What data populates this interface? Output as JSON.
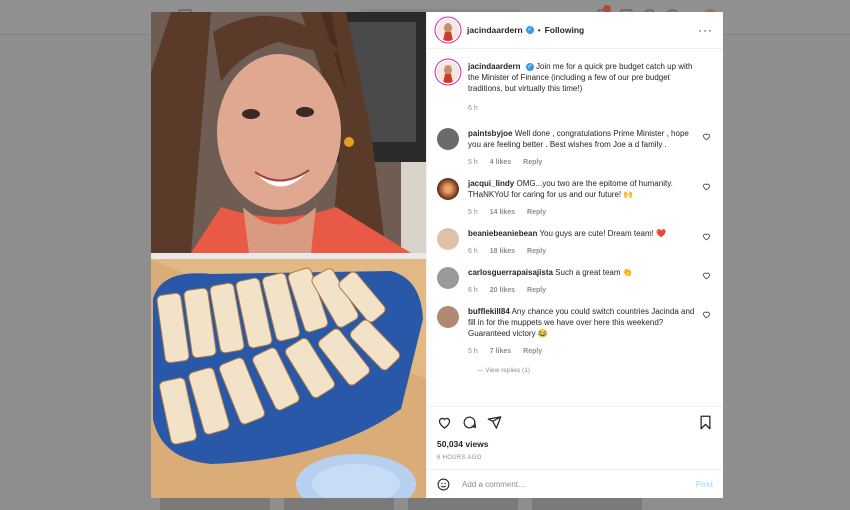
{
  "post": {
    "author": "jacindaardern",
    "follow_status": "Following",
    "dot": "•",
    "more": "···",
    "caption": "Join me for a quick pre budget catch up with the Minister of Finance (including a few of our pre budget traditions, but virtually this time!)",
    "caption_time": "6 h"
  },
  "comments": [
    {
      "user": "paintsbyjoe",
      "text": "Well done , congratulations Prime Minister , hope you are feeling better . Best wishes from Joe a d family .",
      "time": "5 h",
      "likes": "4 likes",
      "reply": "Reply",
      "avatar_color": "#6b6b6b"
    },
    {
      "user": "jacqui_lindy",
      "text": "OMG...you two are the epitome of humanity. THaNKYoU for caring for us and our future! 🙌",
      "time": "5 h",
      "likes": "14 likes",
      "reply": "Reply",
      "avatar_color": "#c46a3a"
    },
    {
      "user": "beaniebeaniebean",
      "text": "You guys are cute! Dream team! ❤️",
      "time": "6 h",
      "likes": "18 likes",
      "reply": "Reply",
      "avatar_color": "#d8b89a"
    },
    {
      "user": "carlosguerrapaisajista",
      "text": "Such a great team 👏",
      "time": "6 h",
      "likes": "20 likes",
      "reply": "Reply",
      "avatar_color": "#9a9a9a"
    },
    {
      "user": "bufflekill84",
      "text": "Any chance you could switch countries Jacinda and fill in for the muppets we have over here this weekend? Guaranteed victory 😂",
      "time": "5 h",
      "likes": "7 likes",
      "reply": "Reply",
      "avatar_color": "#b08a70"
    }
  ],
  "view_replies": "— View replies (1)",
  "stats": {
    "views": "50,034 views",
    "time_ago": "6 HOURS AGO"
  },
  "add_comment": {
    "placeholder": "Add a comment...",
    "post_label": "Post"
  },
  "icons": {
    "like": "heart-icon",
    "comment": "comment-icon",
    "share": "share-icon",
    "save": "bookmark-icon",
    "emoji": "emoji-icon",
    "verified": "verified-badge-icon"
  },
  "colors": {
    "verified_blue": "#3897f0",
    "post_disabled": "#b2dffc",
    "story_ring": "#d6249f"
  }
}
